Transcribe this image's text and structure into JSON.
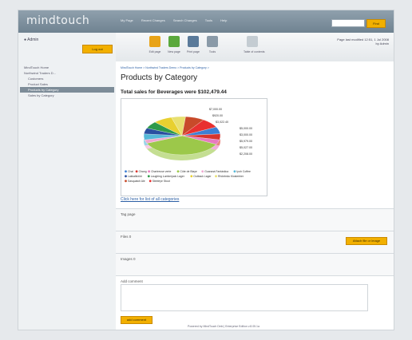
{
  "header": {
    "logo": "mindtouch",
    "nav": [
      "My Page",
      "Recent Changes",
      "Search Changes",
      "Tools",
      "Help"
    ],
    "search_placeholder": "",
    "find_label": "Find"
  },
  "sidebar": {
    "user": "Admin",
    "logout_label": "Log out",
    "items": [
      {
        "label": "MindTouch Home",
        "active": false,
        "indent": false
      },
      {
        "label": "Northwind Traders D...",
        "active": false,
        "indent": false
      },
      {
        "label": "Customers",
        "active": false,
        "indent": true
      },
      {
        "label": "Product Sales",
        "active": false,
        "indent": true
      },
      {
        "label": "Products by Category",
        "active": true,
        "indent": true
      },
      {
        "label": "Sales by Category",
        "active": false,
        "indent": true
      }
    ]
  },
  "toolbar": {
    "tools": [
      {
        "label": "Edit page",
        "icon": "pencil-icon",
        "color": "#e8a317"
      },
      {
        "label": "New page",
        "icon": "new-page-icon",
        "color": "#5aa83c"
      },
      {
        "label": "Print page",
        "icon": "print-icon",
        "color": "#5a7a9a"
      },
      {
        "label": "Tools",
        "icon": "tools-icon",
        "color": "#8a9aa8"
      },
      {
        "label": "Table of contents",
        "icon": "toc-icon",
        "color": "#c4ccd2"
      }
    ],
    "page_info_line1": "Page last modified 12:51, 1 Jul 2008",
    "page_info_line2": "by Admin"
  },
  "content": {
    "breadcrumb": "MindTouch Home > Northwind Traders Demo > Products by Category >",
    "title": "Products by Category",
    "chart_heading": "Total sales for Beverages were $102,479.44",
    "chart_link": "Click here for list of all categories",
    "tag_label": "Tag page",
    "files_label": "Files 0",
    "attach_label": "Attach file or image",
    "images_label": "Images 0",
    "comment_label": "Add comment",
    "add_comment_label": "add comment"
  },
  "chart_data": {
    "type": "pie",
    "labels": [
      "Chai",
      "Chang",
      "Chartreuse verte",
      "Côte de Blaye",
      "Guaraná Fantástica",
      "Ipoh Coffee",
      "Lakkalikööri",
      "Laughing Lumberjack Lager",
      "Outback Lager",
      "Rhönbräu Klosterbier",
      "Sasquatch Ale",
      "Steeleye Stout"
    ],
    "colors": [
      "#3d7fd4",
      "#d8342c",
      "#e87ac0",
      "#9cc84a",
      "#f0a8d0",
      "#55b8d8",
      "#2a4fa0",
      "#2e9a4a",
      "#e8d030",
      "#e8e070",
      "#c84a2a",
      "#e83030"
    ],
    "value_labels": [
      "$7,000.00",
      "$920.00",
      "$3,022.40",
      "$5,000.00",
      "$3,000.00",
      "$5,979.00",
      "$5,027.00",
      "$2,208.00"
    ]
  },
  "footer": {
    "text": "Powered by MindTouch Deki | Enterprise Edition v.8.05.1a"
  }
}
